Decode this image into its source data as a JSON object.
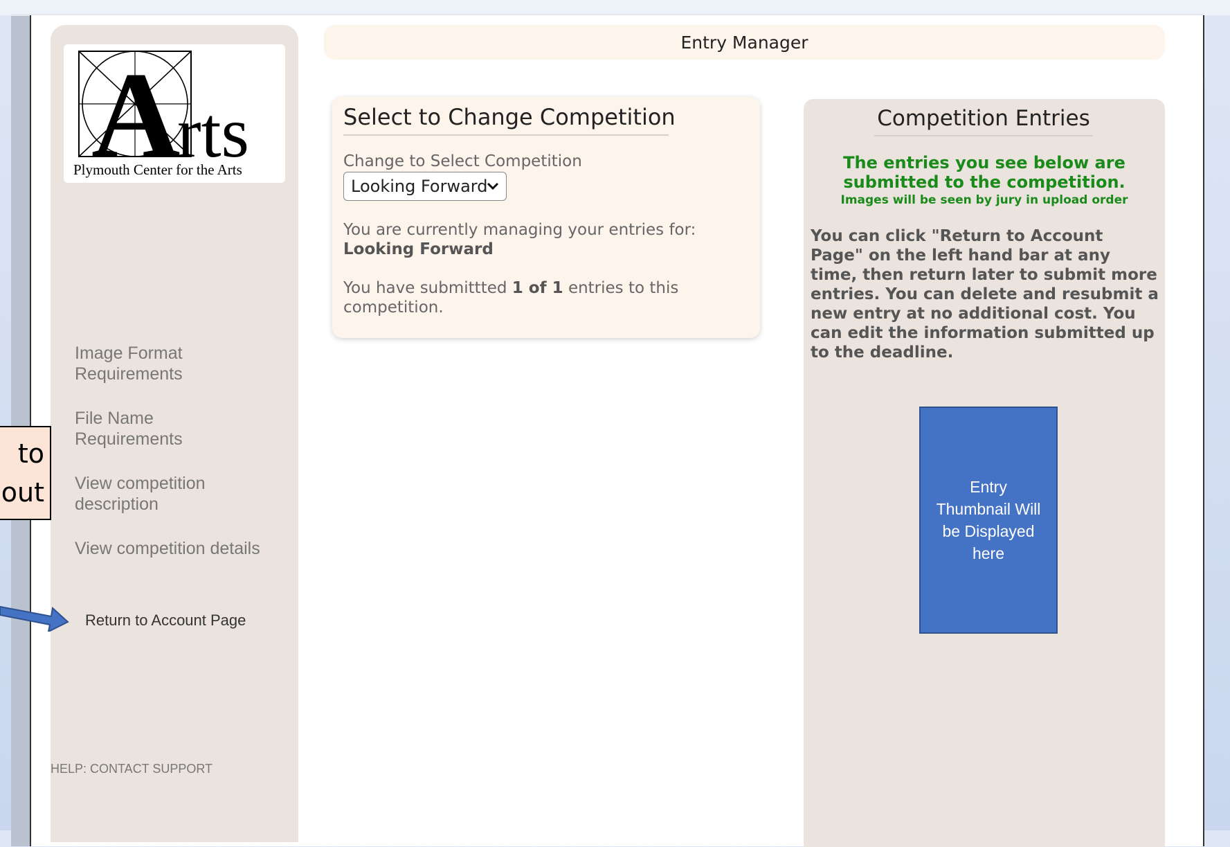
{
  "header": {
    "title": "Entry Manager"
  },
  "logo": {
    "big_letter": "A",
    "rest": "rts",
    "caption": "Plymouth Center for the Arts"
  },
  "sidebar": {
    "links": [
      {
        "label": "Image Format Requirements"
      },
      {
        "label": "File Name Requirements"
      },
      {
        "label": "View competition description"
      },
      {
        "label": "View competition details"
      }
    ],
    "return_label": "Return to Account Page",
    "help_label": "HELP: CONTACT SUPPORT"
  },
  "callout": {
    "line1": "to",
    "line2": "out"
  },
  "select_card": {
    "title": "Select to Change Competition",
    "field_label": "Change to Select Competition",
    "selected_option": "Looking Forward",
    "managing_text": "You are currently managing your entries for:",
    "managing_name": "Looking Forward",
    "submitted_prefix": "You have submittted",
    "submitted_count": "1 of 1",
    "submitted_suffix": "entries to this competition."
  },
  "entries_panel": {
    "title": "Competition Entries",
    "green_heading": "The entries you see below are submitted to the competition.",
    "green_subheading": "Images will be seen by jury in upload order",
    "info": "You can click \"Return to Account Page\" on the left hand bar at any time, then return later to submit more entries. You can delete and resubmit a new entry at no additional cost. You can edit the information submitted up to the deadline.",
    "thumbnail_text": "Entry Thumbnail Will be Displayed here"
  },
  "colors": {
    "accent_blue": "#4472c4",
    "green_text": "#1a8a1a",
    "panel_beige": "#ebe4de",
    "card_cream": "#fdf4ec",
    "callout_peach": "#fce4d6"
  }
}
